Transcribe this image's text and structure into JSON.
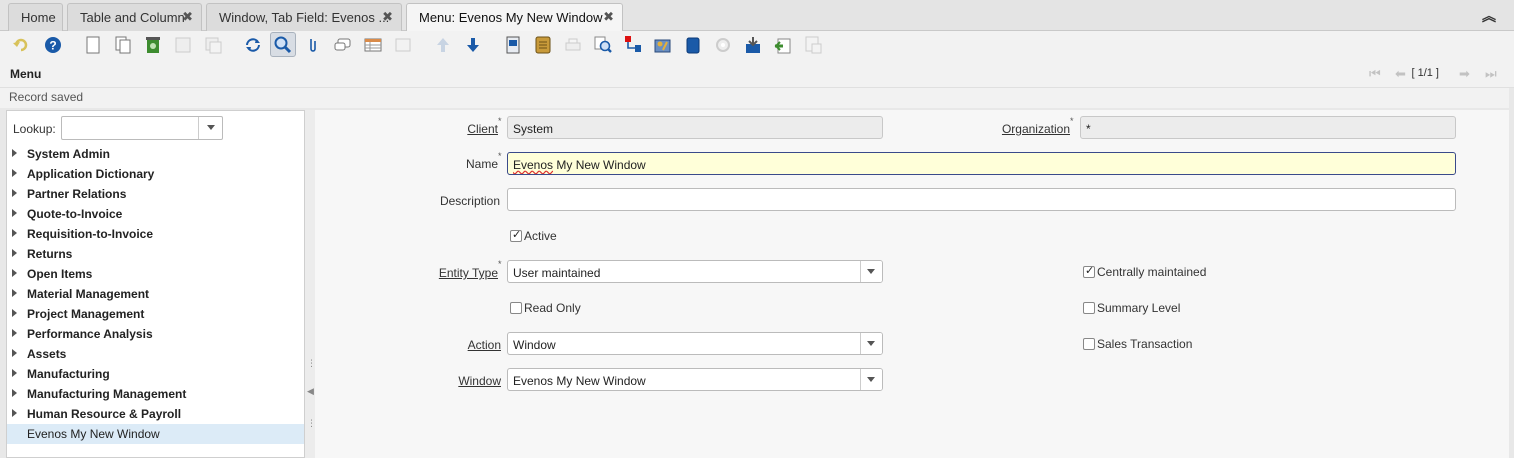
{
  "tabs": [
    {
      "label": "Home",
      "closable": false
    },
    {
      "label": "Table and Column",
      "closable": true
    },
    {
      "label": "Window, Tab Field: Evenos ...",
      "closable": true
    },
    {
      "label": "Menu: Evenos My New Window",
      "closable": true,
      "active": true
    }
  ],
  "toolbar_icons": [
    "undo-icon",
    "help-icon",
    "new-record-icon",
    "copy-record-icon",
    "delete-icon",
    "delete-selection-icon",
    "save-icon",
    "refresh-icon",
    "find-icon",
    "attachment-icon",
    "chat-icon",
    "grid-toggle-icon",
    "parent-record-icon",
    "detail-record-icon",
    "previous-record-icon",
    "next-record-icon",
    "report-icon",
    "archive-icon",
    "print-icon",
    "zoom-across-icon",
    "active-workflows-icon",
    "requests-icon",
    "product-info-icon",
    "customize-icon",
    "export-icon",
    "import-icon",
    "post-icon"
  ],
  "header": {
    "title": "Menu",
    "record_count": "[ 1/1 ]",
    "status": "Record saved"
  },
  "tree": {
    "lookup_label": "Lookup:",
    "lookup_value": "",
    "items": [
      {
        "label": "System Admin"
      },
      {
        "label": "Application Dictionary"
      },
      {
        "label": "Partner Relations"
      },
      {
        "label": "Quote-to-Invoice"
      },
      {
        "label": "Requisition-to-Invoice"
      },
      {
        "label": "Returns"
      },
      {
        "label": "Open Items"
      },
      {
        "label": "Material Management"
      },
      {
        "label": "Project Management"
      },
      {
        "label": "Performance Analysis"
      },
      {
        "label": "Assets"
      },
      {
        "label": "Manufacturing"
      },
      {
        "label": "Manufacturing Management"
      },
      {
        "label": "Human Resource & Payroll"
      },
      {
        "label": "Evenos My New Window"
      }
    ]
  },
  "form": {
    "client_label": "Client",
    "client_value": "System",
    "organization_label": "Organization",
    "organization_value": "*",
    "name_label": "Name",
    "name_value_word1": "Evenos",
    "name_value_rest": " My New Window",
    "description_label": "Description",
    "description_value": "",
    "active_label": "Active",
    "active_checked": true,
    "entity_type_label": "Entity Type",
    "entity_type_value": "User maintained",
    "centrally_maintained_label": "Centrally maintained",
    "centrally_maintained_checked": true,
    "read_only_label": "Read Only",
    "read_only_checked": false,
    "summary_level_label": "Summary Level",
    "summary_level_checked": false,
    "action_label": "Action",
    "action_value": "Window",
    "sales_transaction_label": "Sales Transaction",
    "sales_transaction_checked": false,
    "window_label": "Window",
    "window_value": "Evenos My New Window"
  },
  "colors": {
    "focus_field_bg": "#ffffd9",
    "tree_selected_bg": "#dcebf7",
    "icon_blue": "#1a5aa8",
    "icon_green": "#3d8c2f"
  }
}
